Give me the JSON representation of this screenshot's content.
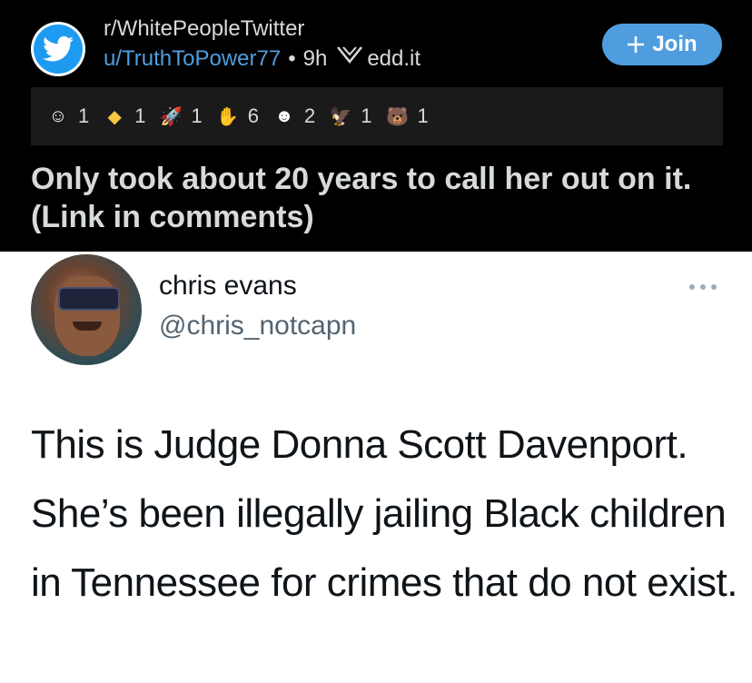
{
  "post": {
    "subreddit": "r/WhitePeopleTwitter",
    "username": "u/TruthToPower77",
    "separator": "•",
    "age": "9h",
    "domain": "edd.it",
    "join_label": "Join",
    "title": "Only took about 20 years to call her out on it. (Link in comments)"
  },
  "awards": [
    {
      "icon": "wholesome-award-icon",
      "glyph": "☺",
      "color": "#ffffff",
      "count": "1"
    },
    {
      "icon": "helpful-award-icon",
      "glyph": "◆",
      "color": "#f5c842",
      "count": "1"
    },
    {
      "icon": "rocket-like-award-icon",
      "glyph": "🚀",
      "color": "#ffffff",
      "count": "1"
    },
    {
      "icon": "hugz-award-icon",
      "glyph": "✋",
      "color": "#ffffff",
      "count": "6"
    },
    {
      "icon": "bravo-award-icon",
      "glyph": "☻",
      "color": "#ffffff",
      "count": "2"
    },
    {
      "icon": "eagle-award-icon",
      "glyph": "🦅",
      "color": "#ffffff",
      "count": "1"
    },
    {
      "icon": "facepalm-award-icon",
      "glyph": "🐻",
      "color": "#b8743a",
      "count": "1"
    }
  ],
  "tweet": {
    "name": "chris evans",
    "handle": "@chris_notcapn",
    "more": "...",
    "body": "This is Judge Donna Scott Davenport. She’s been illegally jailing Black children in Tennessee for crimes that do not exist."
  },
  "colors": {
    "accent": "#4f9dde",
    "header_bg": "#000000",
    "award_bar_bg": "#1a1a1b"
  }
}
